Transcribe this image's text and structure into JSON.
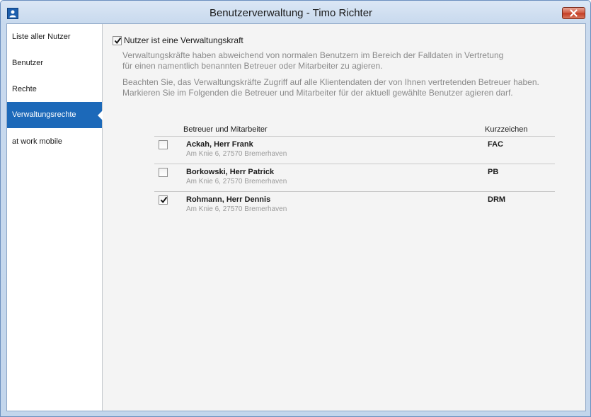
{
  "window": {
    "title": "Benutzerverwaltung - Timo Richter",
    "icons": {
      "app": "user-icon",
      "close": "close-icon"
    }
  },
  "sidebar": {
    "items": [
      {
        "label": "Liste aller Nutzer",
        "active": false
      },
      {
        "label": "Benutzer",
        "active": false
      },
      {
        "label": "Rechte",
        "active": false
      },
      {
        "label": "Verwaltungsrechte",
        "active": true
      },
      {
        "label": "at work mobile",
        "active": false
      }
    ]
  },
  "main": {
    "admin_checkbox": {
      "label": "Nutzer ist eine Verwaltungskraft",
      "checked": true
    },
    "info1": [
      "Verwaltungskräfte haben abweichend von normalen Benutzern im Bereich der Falldaten in Vertretung",
      "für einen namentlich benannten Betreuer oder Mitarbeiter zu agieren."
    ],
    "info2": [
      "Beachten Sie, das Verwaltungskräfte Zugriff auf alle Klientendaten der von Ihnen vertretenden Betreuer haben.",
      "Markieren Sie im Folgenden die Betreuer und Mitarbeiter für der aktuell gewählte Benutzer agieren darf."
    ]
  },
  "table": {
    "columns": [
      "Betreuer und Mitarbeiter",
      "Kurzzeichen"
    ],
    "rows": [
      {
        "name": "Ackah, Herr  Frank",
        "address": "Am Knie 6, 27570 Bremerhaven",
        "code": "FAC",
        "checked": false
      },
      {
        "name": "Borkowski, Herr  Patrick",
        "address": "Am Knie 6, 27570 Bremerhaven",
        "code": "PB",
        "checked": false
      },
      {
        "name": "Rohmann, Herr  Dennis",
        "address": "Am Knie 6, 27570 Bremerhaven",
        "code": "DRM",
        "checked": true
      }
    ]
  },
  "colors": {
    "accent": "#1c69b9",
    "close": "#c94a30"
  }
}
